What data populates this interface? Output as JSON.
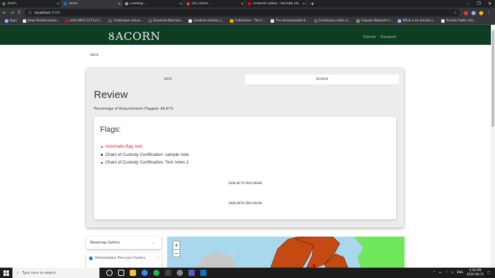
{
  "browser": {
    "tabs": [
      {
        "title": "Acorn",
        "color": "#3c8d40",
        "active": false
      },
      {
        "title": "Acorn",
        "color": "#1a73e8",
        "active": true
      },
      {
        "title": "Loading...",
        "color": "#9aa0a6",
        "active": false
      },
      {
        "title": "(6) | Acorn",
        "color": "#e53935",
        "active": false
      },
      {
        "title": "Channel videos - YouTube Studio",
        "color": "#ff0000",
        "active": false
      }
    ],
    "new_tab": "+",
    "window_controls": [
      "–",
      "❐",
      "✕"
    ],
    "url_host": "localhost",
    "url_port": ":3000",
    "bookmarks": [
      {
        "label": "Apps",
        "color": "#8ab4f8"
      },
      {
        "label": "Deep Reinforcemen...",
        "color": "#e8eaed"
      },
      {
        "label": "arXiv:0811.5171v3 [...",
        "color": "#b31b1b"
      },
      {
        "label": "Continuous online...",
        "color": "#5f6368"
      },
      {
        "label": "Quantum Machine...",
        "color": "#5f6368"
      },
      {
        "label": "handsce-ml/ento_c...",
        "color": "#e8eaed"
      },
      {
        "label": "Collections - The C...",
        "color": "#f5b400"
      },
      {
        "label": "The Unreasonable E...",
        "color": "#e8eaed"
      },
      {
        "label": "Continuous video cl...",
        "color": "#5f6368"
      },
      {
        "label": "Capsule Networks f...",
        "color": "#4caf50"
      },
      {
        "label": "What is an activity v...",
        "color": "#8ab4f8"
      },
      {
        "label": "Toronto Public Libr...",
        "color": "#e8eaed"
      }
    ]
  },
  "app": {
    "logo": "ACORN",
    "nav": [
      "Github",
      "Devpost"
    ],
    "back": "BACK"
  },
  "review": {
    "tabs": [
      "DATA",
      "REVIEW"
    ],
    "selected_tab": "REVIEW",
    "title": "Review",
    "percentage_text": "Percentage of Requirements Flagged: 66.67%",
    "flags_title": "Flags:",
    "flags": [
      {
        "text": "Automatic flag: test",
        "automatic": true
      },
      {
        "text": "Chain of Custody Certification: sample note",
        "automatic": false
      },
      {
        "text": "Chain of Custody Certification: Test notes 2",
        "automatic": false
      }
    ],
    "sign_in_button": "SIGN IN TO DOCUSIGN",
    "sign_button": "SIGN WITH DOCUSIGN"
  },
  "map": {
    "basemap_label": "Basemap Gallery",
    "layer_label": "Deforestation Tree Loss Clusters",
    "zoom_in": "+",
    "zoom_out": "−"
  },
  "taskbar": {
    "search_placeholder": "Type here to search",
    "lang": "ENG",
    "time": "4:56 PM",
    "date": "2020-08-31"
  }
}
